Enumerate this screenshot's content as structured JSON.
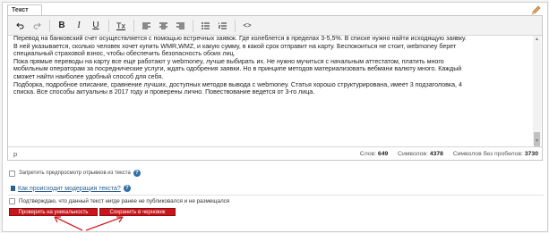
{
  "editor": {
    "tab_label": "Текст",
    "content_lines": [
      "Перевод на банковский счет осуществляется с помощью встречных заявок. Где колеблется в пределах 3-5,5%. В списке нужно найти исходящую заявку.",
      "В ней указывается, сколько человек хочет купить WMR,WMZ, и какую сумму, в какой срок отправит на карту. Беспокоиться не стоит, webmoney берет",
      "специальный страховой взнос, чтобы обеспечить безопасность обоих лиц.",
      "Пока прямые переводы на карту все еще работают у webmoney, лучше выбирать их. Не нужно мучиться с начальным аттестатом, платить много",
      "мобильным операторам за посреднические услуги, ждать одобрения заявки. Но в принципе методов материализовать вебмани валюту много. Каждый",
      "сможет найти наиболее удобный способ для себя.",
      "Подборка, подробное описание, сравнение лучших, доступных методов вывода с webmoney. Статья хорошо структурирована, имеет 3 подзаголовка, 4",
      "списка. Все способы актуальны в 2017 году и проверены лично. Повествование ведется от 3-го лица."
    ],
    "path_element": "p",
    "status": {
      "words_label": "Слов:",
      "words_value": "649",
      "chars_label": "Символов:",
      "chars_value": "4378",
      "chars_nospace_label": "Символов без пробелов:",
      "chars_nospace_value": "3730"
    }
  },
  "toolbar": {
    "buttons": [
      "undo-icon",
      "redo-icon",
      "bold-icon",
      "italic-icon",
      "underline-icon",
      "clear-format-icon",
      "align-left-icon",
      "align-center-icon",
      "align-right-icon",
      "bulleted-list-icon",
      "numbered-list-icon",
      "source-code-icon"
    ],
    "bold_label": "B",
    "italic_label": "I",
    "underline_label": "U",
    "clear_label": "Tx",
    "source_label": "<>"
  },
  "options": {
    "preview_label": "Запретить предпросмотр отрывков из текста",
    "moderation_link": "Как происходит модерация текста?",
    "confirm_label": "Подтверждаю, что данный текст нигде ранее не публиковался и не размещался"
  },
  "buttons": {
    "check_label": "Проверить на уникальность",
    "save_label": "Сохранить в черновик"
  },
  "colors": {
    "accent_red": "#c8151b",
    "link_blue": "#2b5e8a",
    "arrow_red": "#d21f25"
  }
}
